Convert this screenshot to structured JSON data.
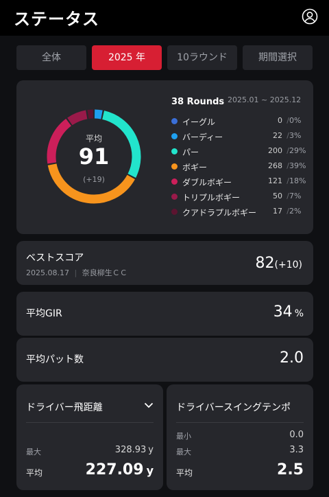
{
  "header": {
    "title": "ステータス",
    "icon": "user-circle-icon"
  },
  "tabs": [
    {
      "label": "全体",
      "active": false
    },
    {
      "label": "2025 年",
      "active": true
    },
    {
      "label": "10ラウンド",
      "active": false
    },
    {
      "label": "期間選択",
      "active": false
    }
  ],
  "summary": {
    "avg_label": "平均",
    "avg_value": "91",
    "avg_sub": "(+19)",
    "rounds": "38 Rounds",
    "range": "2025.01 ~ 2025.12",
    "items": [
      {
        "name": "イーグル",
        "count": "0",
        "pct": "0%",
        "color": "#3a6fd8",
        "value": 0
      },
      {
        "name": "バーディー",
        "count": "22",
        "pct": "3%",
        "color": "#1ea0f0",
        "value": 22
      },
      {
        "name": "パー",
        "count": "200",
        "pct": "29%",
        "color": "#22e4cc",
        "value": 200
      },
      {
        "name": "ボギー",
        "count": "268",
        "pct": "39%",
        "color": "#f7941d",
        "value": 268
      },
      {
        "name": "ダブルボギー",
        "count": "121",
        "pct": "18%",
        "color": "#cc1f5a",
        "value": 121
      },
      {
        "name": "トリプルボギー",
        "count": "50",
        "pct": "7%",
        "color": "#9a1a4a",
        "value": 50
      },
      {
        "name": "クアドラプルボギー",
        "count": "17",
        "pct": "2%",
        "color": "#5c1430",
        "value": 17
      }
    ]
  },
  "best": {
    "label": "ベストスコア",
    "date": "2025.08.17",
    "course": "奈良柳生ＣＣ",
    "value": "82",
    "plus": "(+10)"
  },
  "gir": {
    "label": "平均GIR",
    "value": "34",
    "unit": "%"
  },
  "putt": {
    "label": "平均パット数",
    "value": "2.0"
  },
  "driver": {
    "title": "ドライバー飛距離",
    "max_label": "最大",
    "max_value": "328.93",
    "max_unit": "y",
    "avg_label": "平均",
    "avg_value": "227.09",
    "avg_unit": "y"
  },
  "tempo": {
    "title": "ドライバースイングテンポ",
    "min_label": "最小",
    "min_value": "0.0",
    "max_label": "最大",
    "max_value": "3.3",
    "avg_label": "平均",
    "avg_value": "2.5"
  }
}
